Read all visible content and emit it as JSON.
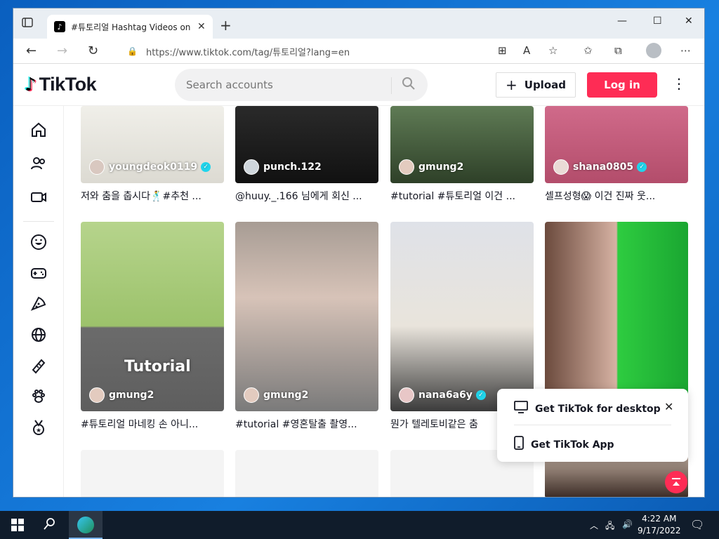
{
  "browser": {
    "tab_title": "#튜토리얼 Hashtag Videos on TikTok",
    "url": "https://www.tiktok.com/tag/튜토리얼?lang=en"
  },
  "header": {
    "logo_text": "TikTok",
    "search_placeholder": "Search accounts",
    "upload_label": "Upload",
    "login_label": "Log in"
  },
  "videos": [
    {
      "user": "youngdeok0119",
      "verified": true,
      "caption": "저와 춤을 춥시다🕺#추천 ..."
    },
    {
      "user": "punch.122",
      "verified": false,
      "caption": "@huuy._.166 님에게 회신 ..."
    },
    {
      "user": "gmung2",
      "verified": false,
      "caption": "#tutorial #튜토리얼 이건 ..."
    },
    {
      "user": "shana0805",
      "verified": true,
      "caption": "셀프성형😱 이건 진짜 웃..."
    },
    {
      "user": "gmung2",
      "verified": false,
      "caption": "#튜토리얼 마네킹 손 아니...",
      "overlay": "Tutorial"
    },
    {
      "user": "gmung2",
      "verified": false,
      "caption": "#tutorial #영혼탈출 촬영..."
    },
    {
      "user": "nana6a6y",
      "verified": true,
      "caption": "뭔가 텔레토비같은 춤"
    },
    {
      "user": "",
      "verified": false,
      "caption": ""
    }
  ],
  "popup": {
    "desktop_label": "Get TikTok for desktop",
    "app_label": "Get TikTok App"
  },
  "taskbar": {
    "time": "4:22 AM",
    "date": "9/17/2022"
  },
  "colors": {
    "brand": "#fe2c55",
    "verified": "#20d5ec"
  }
}
